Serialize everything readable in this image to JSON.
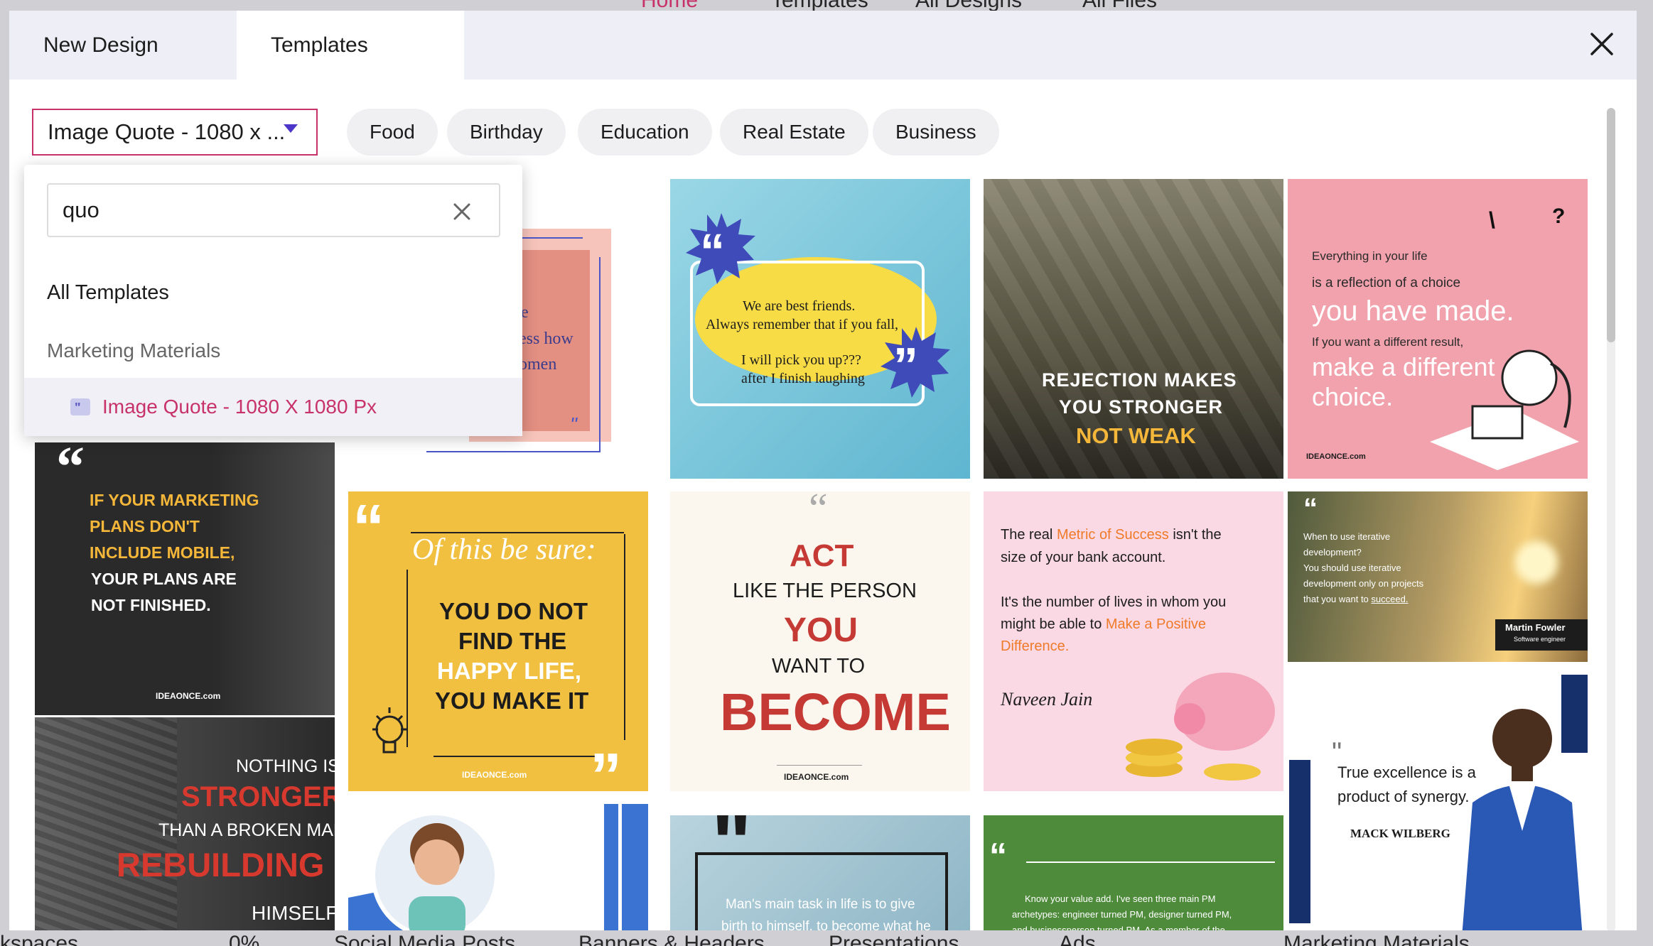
{
  "background": {
    "nav_items": [
      "Home",
      "Templates",
      "All Designs",
      "All Files"
    ],
    "bottom_items": [
      "kspaces",
      "0%",
      "Social Media Posts",
      "Banners & Headers",
      "Presentations",
      "Ads",
      "Marketing Materials"
    ]
  },
  "tabs": [
    {
      "label": "New Design"
    },
    {
      "label": "Templates"
    }
  ],
  "filter": {
    "selected": "Image Quote - 1080 x ...",
    "chips": [
      "Food",
      "Birthday",
      "Education",
      "Real Estate",
      "Business"
    ]
  },
  "dropdown": {
    "search_value": "quo",
    "option_all": "All Templates",
    "group_label": "Marketing Materials",
    "selected_option": "Image Quote - 1080 X 1080 Px"
  },
  "templates": {
    "friends": {
      "line1": "We are best friends.",
      "line2": "Always remember that if you fall,",
      "line3": "I will pick you up???",
      "line4": "after I finish laughing"
    },
    "rejection": {
      "line1": "REJECTION MAKES",
      "line2": "YOU STRONGER",
      "line3": "NOT WEAK"
    },
    "choice": {
      "line1": "Everything in your life",
      "line2": "is a reflection of a choice",
      "line3": "you have made.",
      "line4": "If you want a different result,",
      "line5": "make a different",
      "line6": "choice.",
      "brand": "IDEAONCE.com"
    },
    "pink_partial": {
      "line1": "e",
      "line2": "ess how",
      "line3": "omen"
    },
    "marketing": {
      "line1": "IF YOUR MARKETING",
      "line2": "PLANS DON'T",
      "line3": "INCLUDE MOBILE,",
      "line4": "YOUR PLANS ARE",
      "line5": "NOT FINISHED.",
      "brand": "IDEAONCE.com"
    },
    "happy": {
      "script": "Of this be sure:",
      "line1": "YOU DO NOT",
      "line2": "FIND THE",
      "line3": "HAPPY LIFE,",
      "line4": "YOU MAKE IT",
      "brand": "IDEAONCE.com"
    },
    "act": {
      "line1": "ACT",
      "line2": "LIKE THE PERSON",
      "line3": "YOU",
      "line4": "WANT TO",
      "line5": "BECOME",
      "brand": "IDEAONCE.com"
    },
    "success": {
      "p1a": "The real ",
      "p1b": "Metric of Success",
      "p1c": " isn't the",
      "p1d": "size of your bank account.",
      "p2a": "It's the number of lives in whom you",
      "p2b": "might be able to ",
      "p2c": "Make a Positive",
      "p2d": "Difference.",
      "signature": "Naveen Jain"
    },
    "iterative": {
      "line1": "When to use iterative",
      "line2": "development?",
      "line3": "You should use iterative",
      "line4": "development only on projects",
      "line5": "that you want to ",
      "line5b": "succeed.",
      "author": "Martin Fowler",
      "role": "Software engineer"
    },
    "stronger": {
      "line1": "NOTHING IS",
      "line2": "STRONGER",
      "line3": "THAN A BROKEN MAN",
      "line4": "REBUILDING",
      "line5": "HIMSELF"
    },
    "mans_task": {
      "line1": "Man's main task in life is to give",
      "line2": "birth to himself, to become what he"
    },
    "value": {
      "line1": "Know your value add. I've seen three main PM",
      "line2": "archetypes: engineer turned PM, designer turned PM,",
      "line3": "and businessperson turned PM. As a member of the"
    },
    "excellence": {
      "line1": "True excellence is a",
      "line2": "product of synergy.",
      "author": "MACK WILBERG"
    }
  },
  "colors": {
    "accent": "#c8326b",
    "caret": "#4b36c7",
    "tab_bg": "#eeeef7"
  }
}
